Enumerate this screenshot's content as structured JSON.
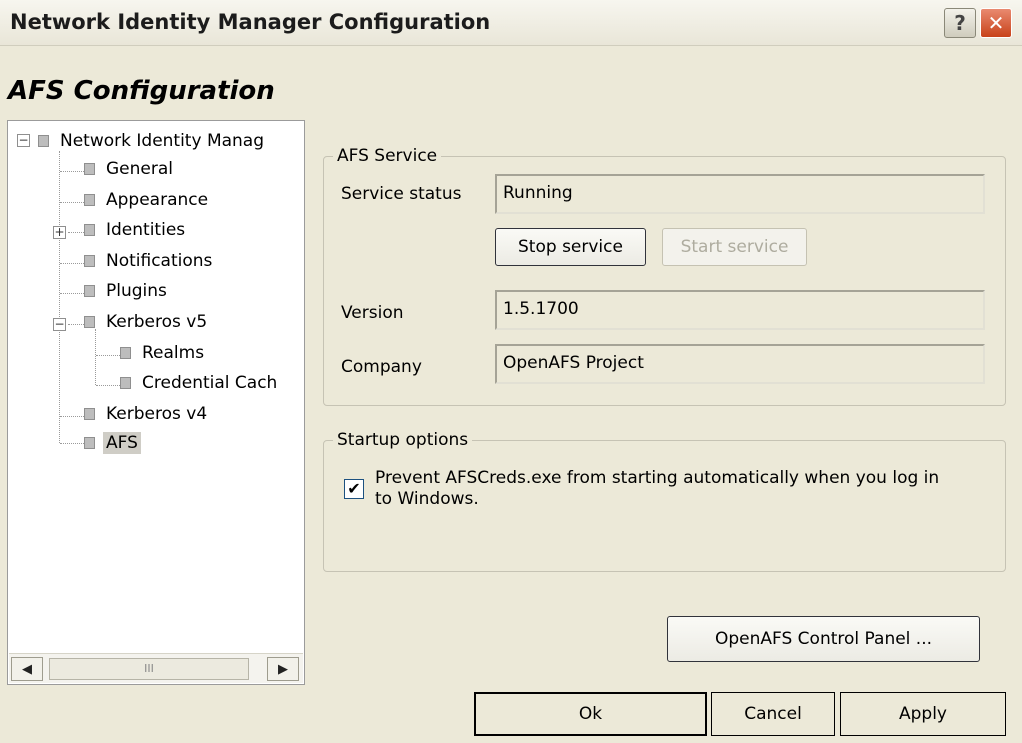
{
  "window": {
    "title": "Network Identity Manager Configuration",
    "help_label": "?",
    "close_label": "✕"
  },
  "page": {
    "heading": "AFS Configuration"
  },
  "tree": {
    "root": "Network Identity Manag",
    "items": {
      "general": "General",
      "appearance": "Appearance",
      "identities": "Identities",
      "notifications": "Notifications",
      "plugins": "Plugins",
      "kerberos5": "Kerberos v5",
      "realms": "Realms",
      "credential_cache": "Credential Cach",
      "kerberos4": "Kerberos v4",
      "afs": "AFS"
    },
    "expand_minus": "−",
    "expand_plus": "+",
    "selected": "AFS",
    "scroll_left": "◀",
    "scroll_right": "▶",
    "scroll_grip": "III"
  },
  "afs_service": {
    "legend": "AFS Service",
    "status_label": "Service status",
    "status_value": "Running",
    "stop_label": "Stop service",
    "start_label": "Start service",
    "version_label": "Version",
    "version_value": "1.5.1700",
    "company_label": "Company",
    "company_value": "OpenAFS Project"
  },
  "startup": {
    "legend": "Startup options",
    "checkbox_checked": true,
    "checkbox_mark": "✔",
    "checkbox_line1": "Prevent AFSCreds.exe from starting automatically when you log in",
    "checkbox_line2": "to Windows."
  },
  "control_panel_label": "OpenAFS Control Panel ...",
  "footer": {
    "ok_label": "Ok",
    "cancel_label": "Cancel",
    "apply_label": "Apply"
  }
}
